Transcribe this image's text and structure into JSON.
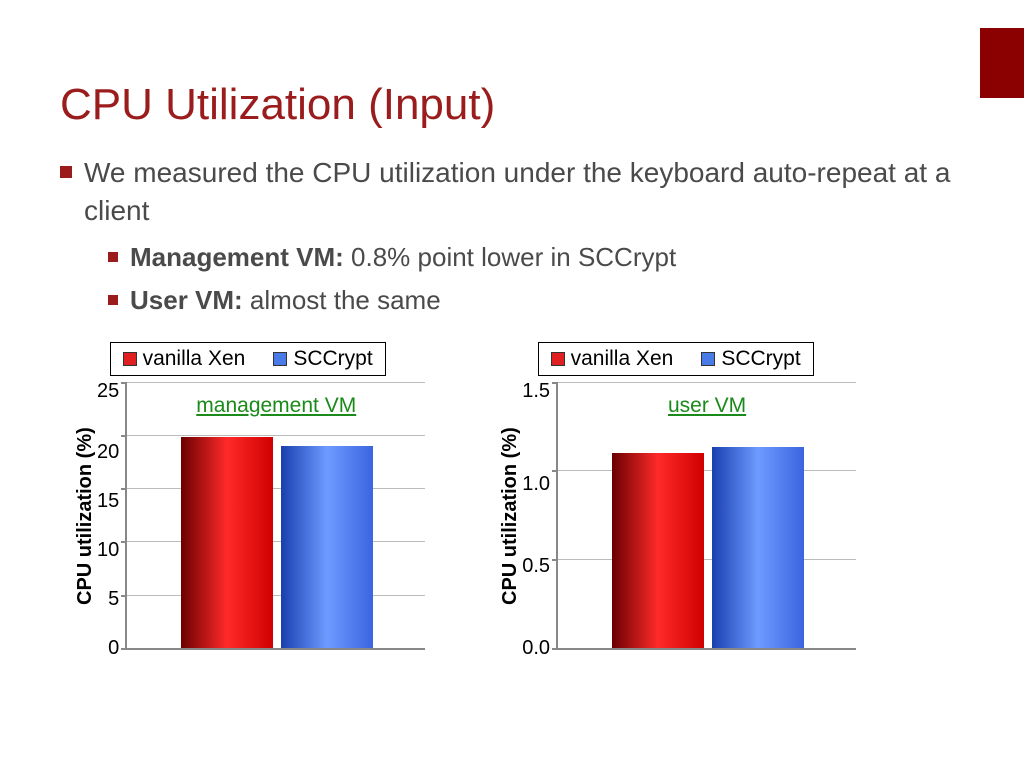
{
  "slide": {
    "title": "CPU Utilization (Input)",
    "main_bullet": "We measured the CPU utilization under the keyboard auto-repeat at a client",
    "sub_bullets": [
      {
        "label": "Management VM:",
        "text": " 0.8% point lower in SCCrypt"
      },
      {
        "label": "User VM:",
        "text": " almost the same"
      }
    ]
  },
  "legend": {
    "series1": "vanilla Xen",
    "series2": "SCCrypt"
  },
  "chart_data": [
    {
      "type": "bar",
      "title": "",
      "annotation": "management VM",
      "ylabel": "CPU utilization (%)",
      "xlabel": "",
      "ylim": [
        0,
        25
      ],
      "yticks": [
        0,
        5,
        10,
        15,
        20,
        25
      ],
      "categories": [
        ""
      ],
      "series": [
        {
          "name": "vanilla Xen",
          "values": [
            19.8
          ]
        },
        {
          "name": "SCCrypt",
          "values": [
            19.0
          ]
        }
      ]
    },
    {
      "type": "bar",
      "title": "",
      "annotation": "user VM",
      "ylabel": "CPU utilization (%)",
      "xlabel": "",
      "ylim": [
        0.0,
        1.5
      ],
      "yticks": [
        0.0,
        0.5,
        1.0,
        1.5
      ],
      "categories": [
        ""
      ],
      "series": [
        {
          "name": "vanilla Xen",
          "values": [
            1.1
          ]
        },
        {
          "name": "SCCrypt",
          "values": [
            1.13
          ]
        }
      ]
    }
  ],
  "ytick_labels": {
    "left": [
      "25",
      "20",
      "15",
      "10",
      "5",
      "0"
    ],
    "right": [
      "1.5",
      "1.0",
      "0.5",
      "0.0"
    ]
  }
}
